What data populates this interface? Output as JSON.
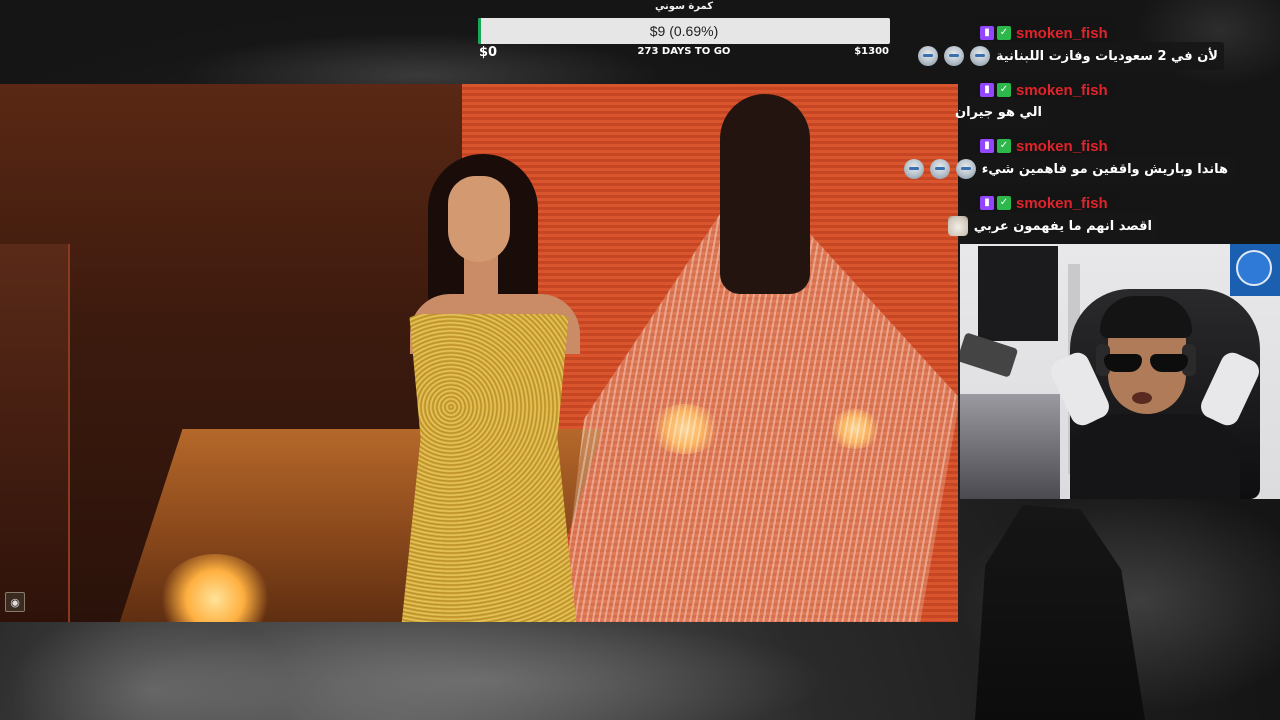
{
  "goal": {
    "title": "كمرة سوني",
    "amount_label": "$9 (0.69%)",
    "progress_percent": 0.69,
    "start_label": "$0",
    "days_label": "273 DAYS TO GO",
    "end_label": "$1300",
    "fill_color": "#18a957"
  },
  "chat": {
    "username_color": "#e0242c",
    "messages": [
      {
        "username": "smoken_fish",
        "text": "لأن في 2 سعوديات وفازت اللبنانية",
        "emotes": 3,
        "emote": "smiling-face-emote"
      },
      {
        "username": "smoken_fish",
        "text": "الي هو جيران",
        "emotes": 0
      },
      {
        "username": "smoken_fish",
        "text": "هاندا وباريش واقفين مو فاهمين شيء",
        "emotes": 3,
        "emote": "smiling-face-emote"
      },
      {
        "username": "smoken_fish",
        "text": "اقصد انهم ما يفهمون عربي",
        "emotes": 1,
        "emote": "dog-emote"
      }
    ]
  }
}
